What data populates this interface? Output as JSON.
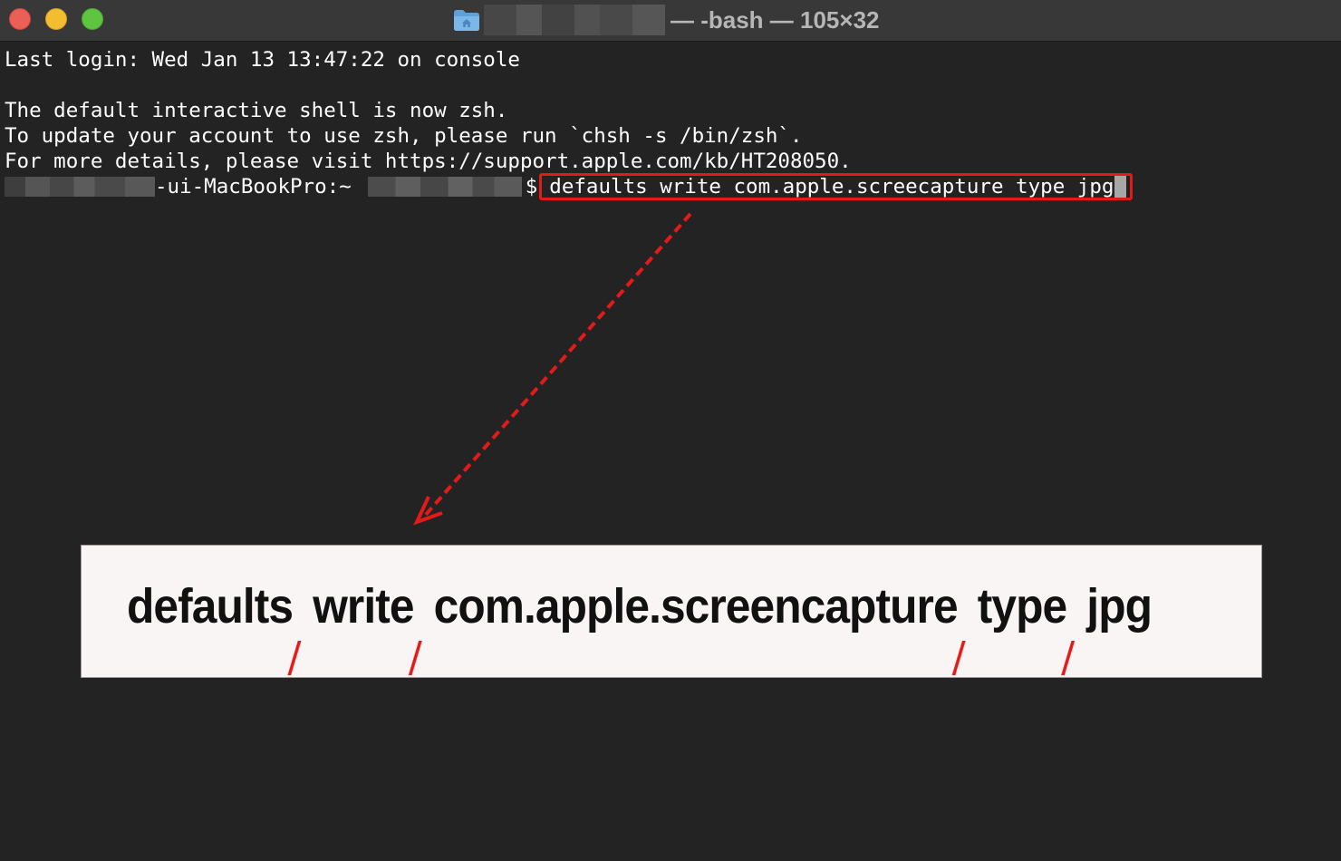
{
  "window": {
    "title_suffix": "— -bash — 105×32"
  },
  "terminal": {
    "lines": [
      "Last login: Wed Jan 13 13:47:22 on console",
      "",
      "The default interactive shell is now zsh.",
      "To update your account to use zsh, please run `chsh -s /bin/zsh`.",
      "For more details, please visit https://support.apple.com/kb/HT208050."
    ],
    "prompt_host": "-ui-MacBookPro:~",
    "prompt_symbol": "$",
    "command": "defaults write com.apple.screecapture type jpg"
  },
  "callout": {
    "tokens": [
      "defaults",
      "write",
      "com.apple.screencapture",
      "type",
      "jpg"
    ]
  },
  "colors": {
    "highlight": "#e31a1a",
    "terminal_bg": "#232323",
    "titlebar_bg": "#383838"
  },
  "icons": {
    "folder": "home-folder-icon"
  }
}
